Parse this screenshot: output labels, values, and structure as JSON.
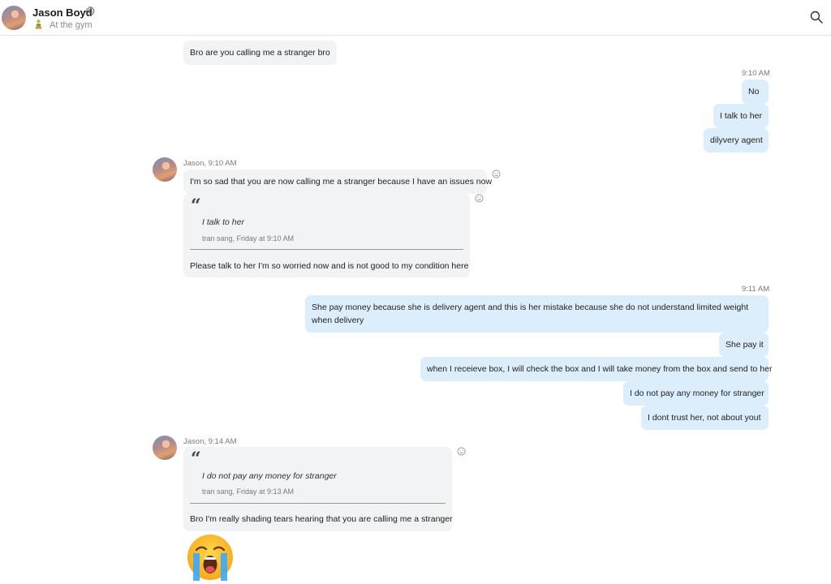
{
  "header": {
    "contact_name": "Jason Boyd",
    "status": "At the gym"
  },
  "messages": {
    "m0": "Bro are you calling me a stranger bro",
    "t1": "9:10 AM",
    "m1": "No",
    "m2": "I talk to her",
    "m3": "dilyvery agent",
    "s1": "Jason, 9:10 AM",
    "m4": "I'm so sad that you are now calling me a stranger because I have an issues now",
    "q1": {
      "quote": "I talk to her",
      "meta": "tran sang, Friday at 9:10 AM",
      "reply": "Please talk to her I'm so worried now and is not good to my condition here"
    },
    "t2": "9:11 AM",
    "m5": "She pay money because she is delivery agent and this is her  mistake because she do not understand limited weight when delivery",
    "m6": "She pay it",
    "m7": "when I receieve box, I will check the box and I will take money from the box and send to her",
    "m8": "I do not pay any money for stranger",
    "m9": "I dont trust her, not about yout",
    "s2": "Jason, 9:14 AM",
    "q2": {
      "quote": "I do not pay any money for stranger",
      "meta": "tran sang, Friday at 9:13 AM",
      "reply": "Bro I'm really shading tears hearing that you are calling me a stranger"
    }
  },
  "colors": {
    "incoming_bubble": "#f1f3f5",
    "outgoing_bubble": "#dceefb"
  },
  "icons": [
    "gear-icon",
    "person-activity-icon",
    "search-icon",
    "add-reaction-icon",
    "crying-face-emoji"
  ]
}
